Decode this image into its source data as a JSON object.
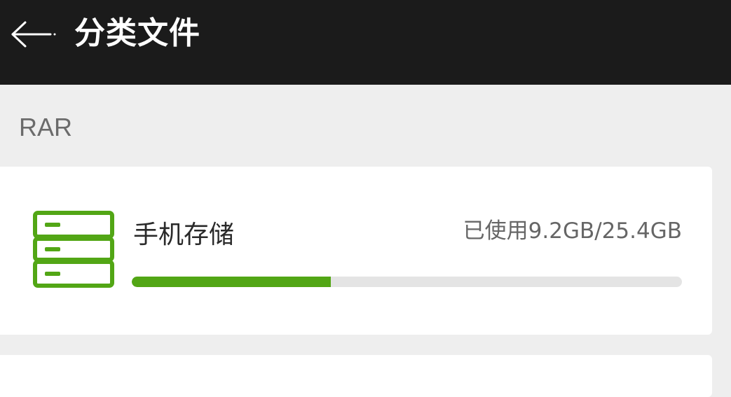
{
  "header": {
    "title": "分类文件",
    "back_icon": "arrow-left-icon"
  },
  "section": {
    "label": "RAR"
  },
  "storage": {
    "name": "手机存储",
    "usage_text": "已使用9.2GB/25.4GB",
    "used_gb": 9.2,
    "total_gb": 25.4,
    "icon": "storage-server-icon"
  },
  "colors": {
    "header_bg": "#1b1b1b",
    "accent_green": "#52a615",
    "track_gray": "#e4e4e4",
    "page_bg": "#eeeeee"
  }
}
